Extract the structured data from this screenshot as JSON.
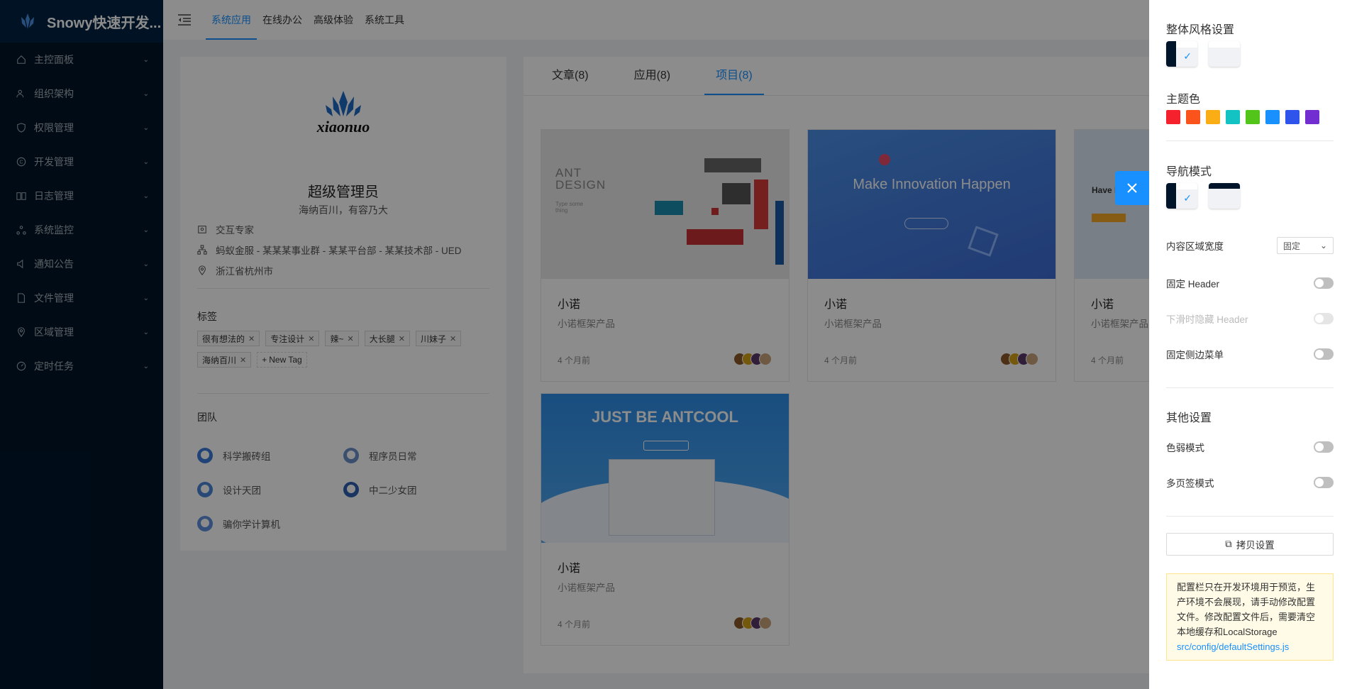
{
  "app": {
    "title": "Snowy快速开发..."
  },
  "sidebar": {
    "items": [
      {
        "label": "主控面板",
        "icon": "home-icon"
      },
      {
        "label": "组织架构",
        "icon": "team-icon"
      },
      {
        "label": "权限管理",
        "icon": "safety-icon"
      },
      {
        "label": "开发管理",
        "icon": "copyright-icon"
      },
      {
        "label": "日志管理",
        "icon": "read-icon"
      },
      {
        "label": "系统监控",
        "icon": "deployment-icon"
      },
      {
        "label": "通知公告",
        "icon": "sound-icon"
      },
      {
        "label": "文件管理",
        "icon": "file-icon"
      },
      {
        "label": "区域管理",
        "icon": "environment-icon"
      },
      {
        "label": "定时任务",
        "icon": "dashboard-icon"
      }
    ]
  },
  "header": {
    "nav": [
      "系统应用",
      "在线办公",
      "高级体验",
      "系统工具"
    ],
    "active_nav": "系统应用"
  },
  "profile": {
    "logo_text": "xiaonuo",
    "name": "超级管理员",
    "bio": "海纳百川，有容乃大",
    "info": [
      {
        "icon": "contacts-icon",
        "text": "交互专家"
      },
      {
        "icon": "cluster-icon",
        "text": "蚂蚁金服 - 某某某事业群 - 某某平台部 - 某某技术部 - UED"
      },
      {
        "icon": "environment-icon",
        "text": "浙江省杭州市"
      }
    ],
    "tags_title": "标签",
    "tags": [
      "很有想法的",
      "专注设计",
      "辣~",
      "大长腿",
      "川妹子",
      "海纳百川"
    ],
    "new_tag": "New Tag",
    "team_title": "团队",
    "team": [
      "科学搬砖组",
      "程序员日常",
      "设计天团",
      "中二少女团",
      "骗你学计算机"
    ]
  },
  "tabs": [
    {
      "label": "文章(8)"
    },
    {
      "label": "应用(8)"
    },
    {
      "label": "项目(8)"
    }
  ],
  "active_tab": "项目(8)",
  "projects": [
    {
      "title": "小诺",
      "desc": "小诺框架产品",
      "time": "4 个月前",
      "cover_text": "ANT DESIGN",
      "cover_sub": "Type some thing"
    },
    {
      "title": "小诺",
      "desc": "小诺框架产品",
      "time": "4 个月前",
      "cover_text": "Make Innovation Happen"
    },
    {
      "title": "小诺",
      "desc": "小诺框架产品",
      "time": "4 个月前",
      "cover_text": "Have F"
    },
    {
      "title": "小诺",
      "desc": "小诺框架产品",
      "time": "4 个月前",
      "cover_text": "JUST BE ANTCOOL"
    }
  ],
  "settings": {
    "style_title": "整体风格设置",
    "theme_title": "主题色",
    "theme_colors": [
      "#f5222d",
      "#fa541c",
      "#faad14",
      "#13c2c2",
      "#52c41a",
      "#1890ff",
      "#2f54eb",
      "#722ed1"
    ],
    "nav_title": "导航模式",
    "content_width_label": "内容区域宽度",
    "content_width_value": "固定",
    "fixed_header": "固定 Header",
    "hide_header": "下滑时隐藏 Header",
    "fixed_sider": "固定侧边菜单",
    "other_title": "其他设置",
    "weak_mode": "色弱模式",
    "multi_tab": "多页签模式",
    "copy_button": "拷贝设置",
    "notice": "配置栏只在开发环境用于预览，生产环境不会展现，请手动修改配置文件。修改配置文件后，需要清空本地缓存和LocalStorage",
    "notice_link": "src/config/defaultSettings.js"
  }
}
